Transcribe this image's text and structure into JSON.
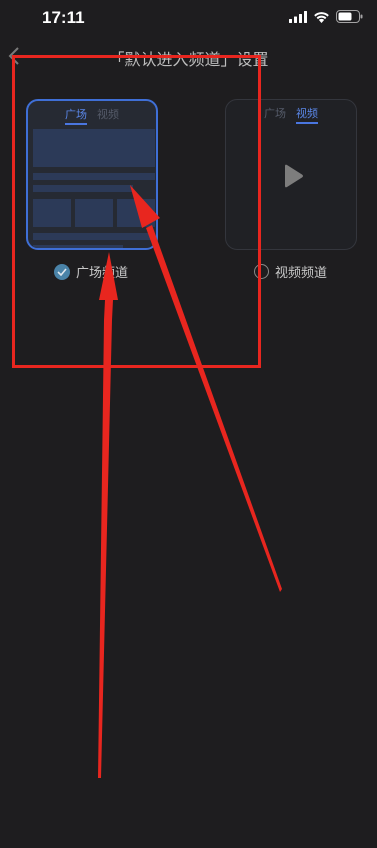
{
  "status_bar": {
    "time": "17:11",
    "icons": [
      "signal-icon",
      "wifi-icon",
      "battery-icon"
    ]
  },
  "nav": {
    "title": "「默认进入频道」设置",
    "back_icon": "chevron-left-icon"
  },
  "options": [
    {
      "label": "广场频道",
      "selected": true,
      "preview_tabs": [
        "广场",
        "视频"
      ],
      "active_tab": "广场"
    },
    {
      "label": "视频频道",
      "selected": false,
      "preview_tabs": [
        "广场",
        "视频"
      ],
      "active_tab": "视频"
    }
  ],
  "colors": {
    "background": "#1e1d1f",
    "accent": "#3f6fd6",
    "check": "#4a83a8",
    "annotation": "#e8261f"
  }
}
